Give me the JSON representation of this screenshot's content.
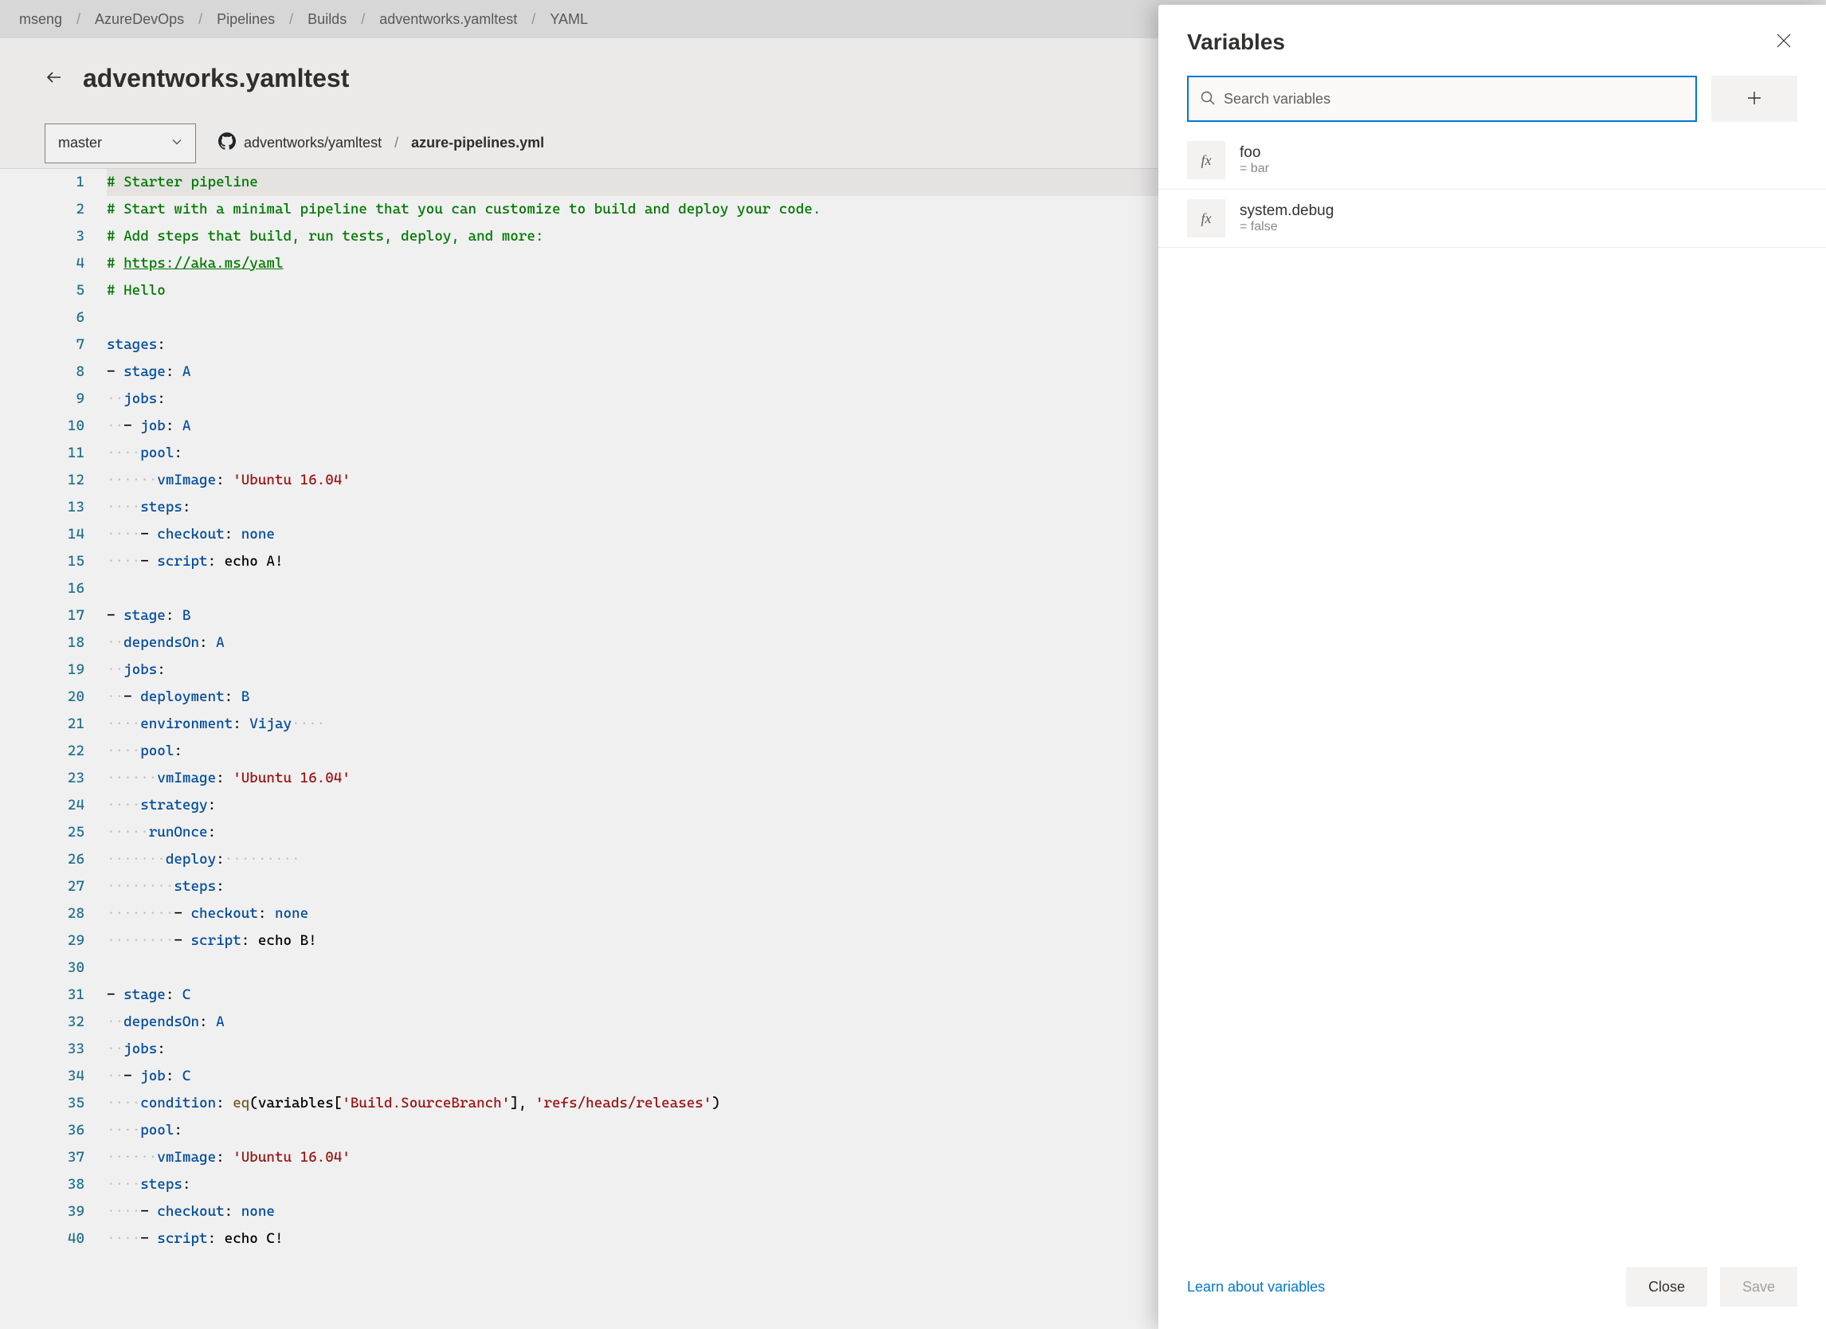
{
  "breadcrumbs": [
    "mseng",
    "AzureDevOps",
    "Pipelines",
    "Builds",
    "adventworks.yamltest",
    "YAML"
  ],
  "page_title": "adventworks.yamltest",
  "branch": {
    "name": "master"
  },
  "repo_path": {
    "repo": "adventworks/yamltest",
    "file": "azure-pipelines.yml"
  },
  "code_lines": [
    [
      {
        "t": "comment",
        "v": "# Starter pipeline"
      }
    ],
    [
      {
        "t": "comment",
        "v": "# Start with a minimal pipeline that you can customize to build and deploy your code."
      }
    ],
    [
      {
        "t": "comment",
        "v": "# Add steps that build, run tests, deploy, and more:"
      }
    ],
    [
      {
        "t": "comment",
        "v": "# "
      },
      {
        "t": "link",
        "v": "https://aka.ms/yaml"
      }
    ],
    [
      {
        "t": "comment",
        "v": "# Hello"
      }
    ],
    [],
    [
      {
        "t": "key",
        "v": "stages"
      },
      {
        "t": "punc",
        "v": ":"
      }
    ],
    [
      {
        "t": "punc",
        "v": "- "
      },
      {
        "t": "key",
        "v": "stage"
      },
      {
        "t": "punc",
        "v": ": "
      },
      {
        "t": "val",
        "v": "A"
      }
    ],
    [
      {
        "t": "ws",
        "v": "  "
      },
      {
        "t": "key",
        "v": "jobs"
      },
      {
        "t": "punc",
        "v": ":"
      }
    ],
    [
      {
        "t": "ws",
        "v": "  "
      },
      {
        "t": "punc",
        "v": "- "
      },
      {
        "t": "key",
        "v": "job"
      },
      {
        "t": "punc",
        "v": ": "
      },
      {
        "t": "val",
        "v": "A"
      }
    ],
    [
      {
        "t": "ws",
        "v": "    "
      },
      {
        "t": "key",
        "v": "pool"
      },
      {
        "t": "punc",
        "v": ":"
      }
    ],
    [
      {
        "t": "ws",
        "v": "      "
      },
      {
        "t": "key",
        "v": "vmImage"
      },
      {
        "t": "punc",
        "v": ": "
      },
      {
        "t": "str",
        "v": "'Ubuntu 16.04'"
      }
    ],
    [
      {
        "t": "ws",
        "v": "    "
      },
      {
        "t": "key",
        "v": "steps"
      },
      {
        "t": "punc",
        "v": ":"
      }
    ],
    [
      {
        "t": "ws",
        "v": "    "
      },
      {
        "t": "punc",
        "v": "- "
      },
      {
        "t": "key",
        "v": "checkout"
      },
      {
        "t": "punc",
        "v": ": "
      },
      {
        "t": "val",
        "v": "none"
      }
    ],
    [
      {
        "t": "ws",
        "v": "    "
      },
      {
        "t": "punc",
        "v": "- "
      },
      {
        "t": "key",
        "v": "script"
      },
      {
        "t": "punc",
        "v": ": "
      },
      {
        "t": "plain",
        "v": "echo A!"
      }
    ],
    [],
    [
      {
        "t": "punc",
        "v": "- "
      },
      {
        "t": "key",
        "v": "stage"
      },
      {
        "t": "punc",
        "v": ": "
      },
      {
        "t": "val",
        "v": "B"
      }
    ],
    [
      {
        "t": "ws",
        "v": "  "
      },
      {
        "t": "key",
        "v": "dependsOn"
      },
      {
        "t": "punc",
        "v": ": "
      },
      {
        "t": "val",
        "v": "A"
      }
    ],
    [
      {
        "t": "ws",
        "v": "  "
      },
      {
        "t": "key",
        "v": "jobs"
      },
      {
        "t": "punc",
        "v": ":"
      }
    ],
    [
      {
        "t": "ws",
        "v": "  "
      },
      {
        "t": "punc",
        "v": "- "
      },
      {
        "t": "key",
        "v": "deployment"
      },
      {
        "t": "punc",
        "v": ": "
      },
      {
        "t": "val",
        "v": "B"
      }
    ],
    [
      {
        "t": "ws",
        "v": "    "
      },
      {
        "t": "key",
        "v": "environment"
      },
      {
        "t": "punc",
        "v": ": "
      },
      {
        "t": "val",
        "v": "Vijay"
      },
      {
        "t": "ws",
        "v": "    "
      }
    ],
    [
      {
        "t": "ws",
        "v": "    "
      },
      {
        "t": "key",
        "v": "pool"
      },
      {
        "t": "punc",
        "v": ":"
      }
    ],
    [
      {
        "t": "ws",
        "v": "      "
      },
      {
        "t": "key",
        "v": "vmImage"
      },
      {
        "t": "punc",
        "v": ": "
      },
      {
        "t": "str",
        "v": "'Ubuntu 16.04'"
      }
    ],
    [
      {
        "t": "ws",
        "v": "    "
      },
      {
        "t": "key",
        "v": "strategy"
      },
      {
        "t": "punc",
        "v": ":"
      }
    ],
    [
      {
        "t": "ws",
        "v": "     "
      },
      {
        "t": "key",
        "v": "runOnce"
      },
      {
        "t": "punc",
        "v": ":"
      }
    ],
    [
      {
        "t": "ws",
        "v": "       "
      },
      {
        "t": "key",
        "v": "deploy"
      },
      {
        "t": "punc",
        "v": ":"
      },
      {
        "t": "ws",
        "v": "         "
      }
    ],
    [
      {
        "t": "ws",
        "v": "        "
      },
      {
        "t": "key",
        "v": "steps"
      },
      {
        "t": "punc",
        "v": ":"
      }
    ],
    [
      {
        "t": "ws",
        "v": "        "
      },
      {
        "t": "punc",
        "v": "- "
      },
      {
        "t": "key",
        "v": "checkout"
      },
      {
        "t": "punc",
        "v": ": "
      },
      {
        "t": "val",
        "v": "none"
      }
    ],
    [
      {
        "t": "ws",
        "v": "        "
      },
      {
        "t": "punc",
        "v": "- "
      },
      {
        "t": "key",
        "v": "script"
      },
      {
        "t": "punc",
        "v": ": "
      },
      {
        "t": "plain",
        "v": "echo B!"
      }
    ],
    [],
    [
      {
        "t": "punc",
        "v": "- "
      },
      {
        "t": "key",
        "v": "stage"
      },
      {
        "t": "punc",
        "v": ": "
      },
      {
        "t": "val",
        "v": "C"
      }
    ],
    [
      {
        "t": "ws",
        "v": "  "
      },
      {
        "t": "key",
        "v": "dependsOn"
      },
      {
        "t": "punc",
        "v": ": "
      },
      {
        "t": "val",
        "v": "A"
      }
    ],
    [
      {
        "t": "ws",
        "v": "  "
      },
      {
        "t": "key",
        "v": "jobs"
      },
      {
        "t": "punc",
        "v": ":"
      }
    ],
    [
      {
        "t": "ws",
        "v": "  "
      },
      {
        "t": "punc",
        "v": "- "
      },
      {
        "t": "key",
        "v": "job"
      },
      {
        "t": "punc",
        "v": ": "
      },
      {
        "t": "val",
        "v": "C"
      }
    ],
    [
      {
        "t": "ws",
        "v": "    "
      },
      {
        "t": "key",
        "v": "condition"
      },
      {
        "t": "punc",
        "v": ": "
      },
      {
        "t": "funcname",
        "v": "eq"
      },
      {
        "t": "plain",
        "v": "(variables["
      },
      {
        "t": "str",
        "v": "'Build.SourceBranch'"
      },
      {
        "t": "plain",
        "v": "], "
      },
      {
        "t": "str",
        "v": "'refs/heads/releases'"
      },
      {
        "t": "plain",
        "v": ")"
      }
    ],
    [
      {
        "t": "ws",
        "v": "    "
      },
      {
        "t": "key",
        "v": "pool"
      },
      {
        "t": "punc",
        "v": ":"
      }
    ],
    [
      {
        "t": "ws",
        "v": "      "
      },
      {
        "t": "key",
        "v": "vmImage"
      },
      {
        "t": "punc",
        "v": ": "
      },
      {
        "t": "str",
        "v": "'Ubuntu 16.04'"
      }
    ],
    [
      {
        "t": "ws",
        "v": "    "
      },
      {
        "t": "key",
        "v": "steps"
      },
      {
        "t": "punc",
        "v": ":"
      }
    ],
    [
      {
        "t": "ws",
        "v": "    "
      },
      {
        "t": "punc",
        "v": "- "
      },
      {
        "t": "key",
        "v": "checkout"
      },
      {
        "t": "punc",
        "v": ": "
      },
      {
        "t": "val",
        "v": "none"
      }
    ],
    [
      {
        "t": "ws",
        "v": "    "
      },
      {
        "t": "punc",
        "v": "- "
      },
      {
        "t": "key",
        "v": "script"
      },
      {
        "t": "punc",
        "v": ": "
      },
      {
        "t": "plain",
        "v": "echo C!"
      }
    ]
  ],
  "panel": {
    "title": "Variables",
    "search_placeholder": "Search variables",
    "variables": [
      {
        "icon": "fx",
        "name": "foo",
        "value": "= bar"
      },
      {
        "icon": "fx",
        "name": "system.debug",
        "value": "= false"
      }
    ],
    "learn_link": "Learn about variables",
    "close_label": "Close",
    "save_label": "Save"
  }
}
